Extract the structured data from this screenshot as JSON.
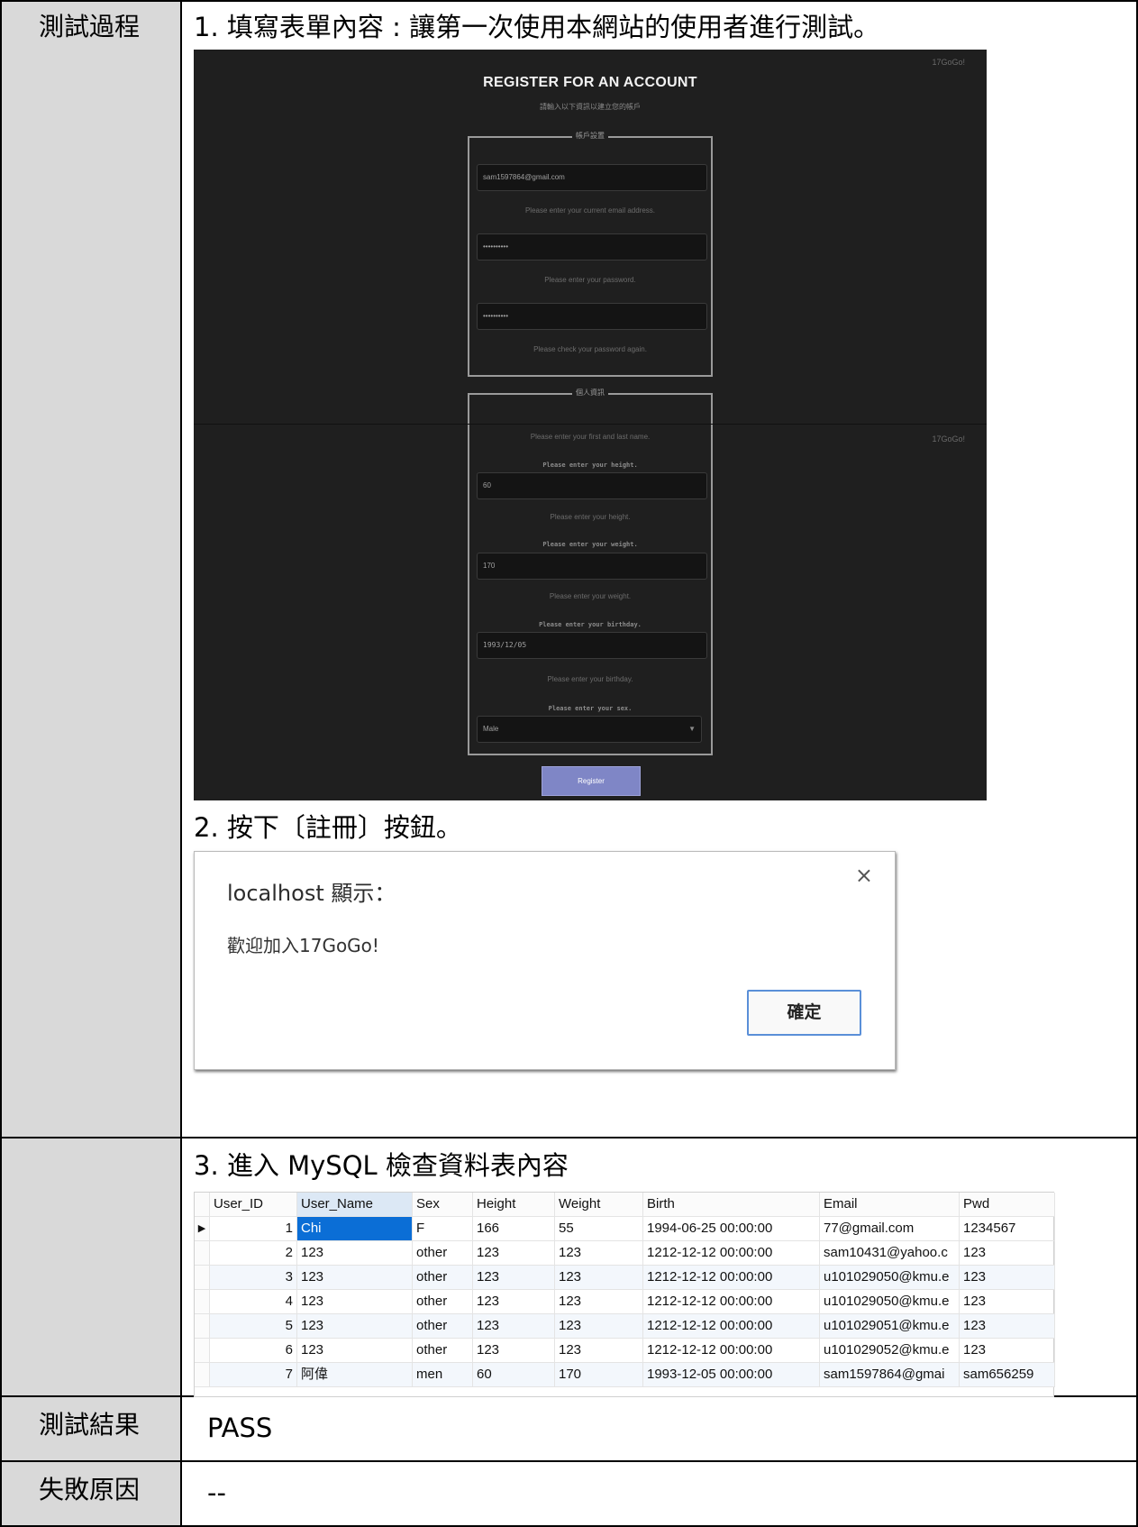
{
  "rows": {
    "process_label": "測試過程",
    "result_label": "測試結果",
    "failure_label": "失敗原因"
  },
  "steps": {
    "step1": "1.  填寫表單內容 : 讓第一次使用本網站的使用者進行測試。",
    "step2": "2.  按下〔註冊〕按鈕。",
    "step3": "3.  進入 MySQL 檢查資料表內容"
  },
  "register_screenshot": {
    "watermark": "17GoGo!",
    "title": "REGISTER FOR AN ACCOUNT",
    "subtitle": "請輸入以下資訊以建立您的帳戶",
    "account_legend": "帳戶設置",
    "email_value": "sam1597864@gmail.com",
    "email_help": "Please enter your current email address.",
    "password_value": "••••••••••",
    "password_help": "Please enter your password.",
    "password_confirm_value": "••••••••••",
    "password_confirm_help": "Please check your password again.",
    "personal_legend": "個人資訊",
    "name_help": "Please enter your first and last name.",
    "height_label": "Please enter your height.",
    "height_value": "60",
    "height_help": "Please enter your height.",
    "weight_label": "Please enter your weight.",
    "weight_value": "170",
    "weight_help": "Please enter your weight.",
    "birthday_label": "Please enter your birthday.",
    "birthday_value": "1993/12/05",
    "birthday_help": "Please enter your birthday.",
    "sex_label": "Please enter your sex.",
    "sex_value": "Male",
    "register_button": "Register",
    "accent_color": "#7f86c6"
  },
  "dialog": {
    "title": "localhost 顯示：",
    "message": "歡迎加入17GoGo!",
    "ok_button": "確定",
    "close_icon": "close-icon"
  },
  "db_table": {
    "columns": [
      "User_ID",
      "User_Name",
      "Sex",
      "Height",
      "Weight",
      "Birth",
      "Email",
      "Pwd"
    ],
    "rows": [
      [
        "1",
        "Chi",
        "F",
        "166",
        "55",
        "1994-06-25 00:00:00",
        "77@gmail.com",
        "1234567"
      ],
      [
        "2",
        "123",
        "other",
        "123",
        "123",
        "1212-12-12 00:00:00",
        "sam10431@yahoo.c",
        "123"
      ],
      [
        "3",
        "123",
        "other",
        "123",
        "123",
        "1212-12-12 00:00:00",
        "u101029050@kmu.e",
        "123"
      ],
      [
        "4",
        "123",
        "other",
        "123",
        "123",
        "1212-12-12 00:00:00",
        "u101029050@kmu.e",
        "123"
      ],
      [
        "5",
        "123",
        "other",
        "123",
        "123",
        "1212-12-12 00:00:00",
        "u101029051@kmu.e",
        "123"
      ],
      [
        "6",
        "123",
        "other",
        "123",
        "123",
        "1212-12-12 00:00:00",
        "u101029052@kmu.e",
        "123"
      ],
      [
        "7",
        "阿偉",
        "men",
        "60",
        "170",
        "1993-12-05 00:00:00",
        "sam1597864@gmai",
        "sam656259"
      ]
    ],
    "current_row_marker": "▶"
  },
  "result": {
    "value": "PASS"
  },
  "failure": {
    "value": "--"
  }
}
